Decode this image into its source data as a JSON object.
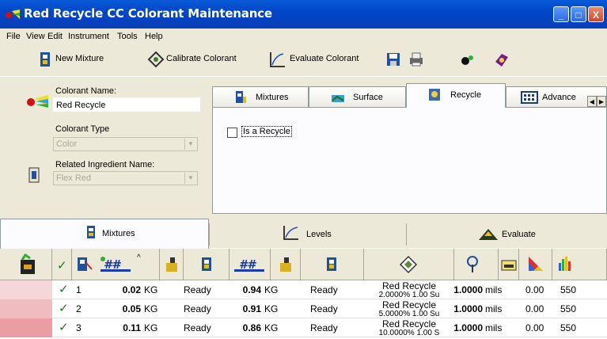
{
  "window": {
    "title": "Red Recycle CC Colorant Maintenance",
    "min_glyph": "_",
    "max_glyph": "□",
    "close_glyph": "X"
  },
  "menu": [
    "File",
    "View",
    "Edit",
    "Instrument",
    "Tools",
    "Help"
  ],
  "toolbar": {
    "new_mixture": "New Mixture",
    "calibrate_colorant": "Calibrate Colorant",
    "evaluate_colorant": "Evaluate Colorant"
  },
  "colorant": {
    "name_label": "Colorant Name:",
    "name_value": "Red Recycle",
    "type_label": "Colorant Type",
    "type_value": "Color",
    "ingredient_label": "Related Ingredient Name:",
    "ingredient_value": "Flex Red"
  },
  "tabs": {
    "mixtures": "Mixtures",
    "surface": "Surface",
    "recycle": "Recycle",
    "advanced": "Advance"
  },
  "recycle_panel": {
    "is_recycle_label": "Is a Recycle",
    "is_recycle_checked": false
  },
  "bottom_tabs": {
    "mixtures": "Mixtures",
    "levels": "Levels",
    "evaluate": "Evaluate"
  },
  "grid": {
    "rows": [
      {
        "num": "1",
        "check": "✓",
        "qty1": "0.02",
        "unit1": "KG",
        "status1": "Ready",
        "qty2": "0.94",
        "unit2": "KG",
        "status2": "Ready",
        "name": "Red Recycle",
        "sub": "2.0000% 1.00 Su",
        "thick": "1.0000",
        "thick_unit": "mils",
        "v1": "0.00",
        "v2": "550",
        "color": "#f6d7d9"
      },
      {
        "num": "2",
        "check": "✓",
        "qty1": "0.05",
        "unit1": "KG",
        "status1": "Ready",
        "qty2": "0.91",
        "unit2": "KG",
        "status2": "Ready",
        "name": "Red Recycle",
        "sub": "5.0000% 1.00 Su",
        "thick": "1.0000",
        "thick_unit": "mils",
        "v1": "0.00",
        "v2": "550",
        "color": "#f1bcc0"
      },
      {
        "num": "3",
        "check": "✓",
        "qty1": "0.11",
        "unit1": "KG",
        "status1": "Ready",
        "qty2": "0.86",
        "unit2": "KG",
        "status2": "Ready",
        "name": "Red Recycle",
        "sub": "10.0000% 1.00 S",
        "thick": "1.0000",
        "thick_unit": "mils",
        "v1": "0.00",
        "v2": "550",
        "color": "#ea9ea4"
      }
    ]
  }
}
